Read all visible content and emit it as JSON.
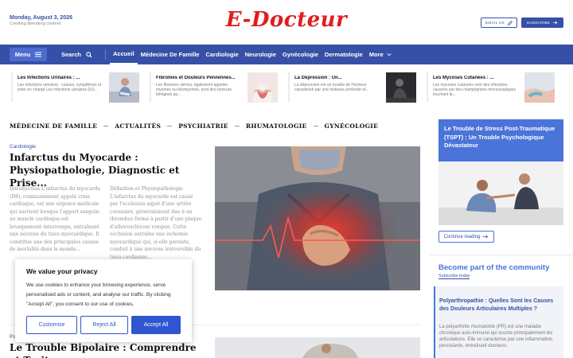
{
  "header": {
    "date": "Monday, August 3, 2026",
    "tagline": "Creating liberating content",
    "logo": "E-Docteur",
    "email_label": "EMAIL US",
    "subscribe_label": "SUBSCRIBE"
  },
  "nav": {
    "menu_label": "Menu",
    "search_label": "Search",
    "items": [
      "Accueil",
      "Médecine De Famille",
      "Cardiologie",
      "Neurologie",
      "Gynécologie",
      "Dermatologie",
      "More"
    ]
  },
  "trending": [
    {
      "title": "Les Infections Urinaires : ...",
      "text": "Les infections urinaires : causes, symptômes et prise en charge Les infections urinaires (IU)..."
    },
    {
      "title": "Fibromes et Douleurs Pelviennes...",
      "text": "Les fibromes utérins, également appelés myomes ou léiomyomes, sont des tumeurs bénignes qu..."
    },
    {
      "title": "La Dépression : Un...",
      "text": "La dépression est un trouble de l'humeur caractérisé par une tristesse profonde et..."
    },
    {
      "title": "Les Mycoses Cutanées : ...",
      "text": "Les mycoses cutanées sont des infections causées par des champignons microscopiques touchant la..."
    }
  ],
  "categories": [
    "MÉDECINE DE FAMILLE",
    "ACTUALITÉS",
    "PSYCHIATRIE",
    "RHUMATOLOGIE",
    "GYNÉCOLOGIE"
  ],
  "main_article": {
    "kicker": "Cardiologie",
    "title": "Infarctus du Myocarde : Physiopathologie, Diagnostic et Prise...",
    "col1": "Introduction L'infarctus du myocarde (IM), communément appelé crise cardiaque, est une urgence médicale qui survient lorsque l'apport sanguin au muscle cardiaque est brusquement interrompu, entraînant une nécrose du tissu myocardique. Il constitue une des principales causes de mortalité dans le monde...",
    "col2": "Définition et Physiopathologie L'infarctus du myocarde est causé par l'occlusion aiguë d'une artère coronaire, généralement due à un thrombus formé à partir d'une plaque d'athérosclérose rompue. Cette occlusion entraîne une ischémie myocardique qui, si elle persiste, conduit à une nécrose irréversible du tissu cardiaque..."
  },
  "second_article": {
    "kicker": "Psychiatrie",
    "title": "Le Trouble Bipolaire : Comprendre et Traiter..."
  },
  "sidebar": {
    "card_title": "Le Trouble de Stress Post-Traumatique (TSPT) : Un Trouble Psychologique Dévastateur",
    "continue_label": "Continue reading",
    "community_title": "Become part of the community",
    "community_sub": "Subscribe today",
    "post_title": "Polyarthropathie : Quelles Sont les Causes des Douleurs Articulaires Multiples ?",
    "post_text": "La polyarthrite rhumatoïde (PR) est une maladie chronique auto-immune qui touche principalement les articulations. Elle se caractérise par une inflammation persistante, entraînant douleurs,"
  },
  "cookie": {
    "title": "We value your privacy",
    "text": "We use cookies to enhance your browsing experience, serve personalised ads or content, and analyse our traffic. By clicking \"Accept All\", you consent to our use of cookies.",
    "customise": "Customise",
    "reject": "Reject All",
    "accept": "Accept All"
  },
  "colors": {
    "brand_blue": "#3550a6",
    "logo_red": "#e11d1d",
    "accent_blue": "#4a74d8"
  }
}
